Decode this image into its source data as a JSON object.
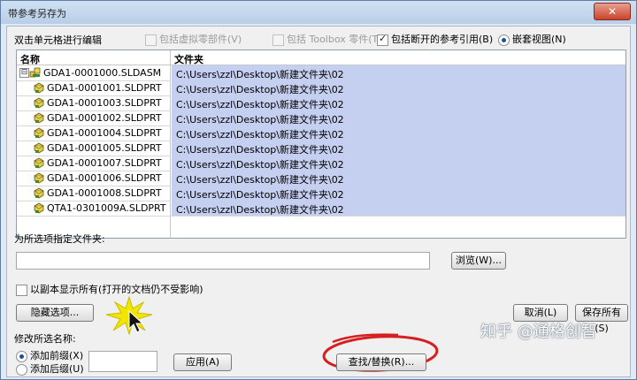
{
  "window": {
    "title": "带参考另存为",
    "close_label": "✕"
  },
  "top_options": {
    "hint": "双击单元格进行编辑",
    "include_virtual": {
      "label": "包括虚拟零部件(V)",
      "checked": false,
      "disabled": true
    },
    "include_toolbox": {
      "label": "包括 Toolbox 零件(T)",
      "checked": false,
      "disabled": true
    },
    "include_broken": {
      "label": "包括断开的参考引用(B)",
      "checked": true,
      "disabled": false
    },
    "nested_view": {
      "label": "嵌套视图(N)",
      "selected": true
    }
  },
  "grid": {
    "columns": [
      "名称",
      "文件夹"
    ],
    "tree_toggle": "⊟",
    "rows": [
      {
        "name": "GDA1-0001000.SLDASM",
        "folder": "C:\\Users\\zzl\\Desktop\\新建文件夹\\02",
        "icon": "assembly-icon"
      },
      {
        "name": "GDA1-0001001.SLDPRT",
        "folder": "C:\\Users\\zzl\\Desktop\\新建文件夹\\02",
        "icon": "part-icon"
      },
      {
        "name": "GDA1-0001003.SLDPRT",
        "folder": "C:\\Users\\zzl\\Desktop\\新建文件夹\\02",
        "icon": "part-icon"
      },
      {
        "name": "GDA1-0001002.SLDPRT",
        "folder": "C:\\Users\\zzl\\Desktop\\新建文件夹\\02",
        "icon": "part-icon"
      },
      {
        "name": "GDA1-0001004.SLDPRT",
        "folder": "C:\\Users\\zzl\\Desktop\\新建文件夹\\02",
        "icon": "part-icon"
      },
      {
        "name": "GDA1-0001005.SLDPRT",
        "folder": "C:\\Users\\zzl\\Desktop\\新建文件夹\\02",
        "icon": "part-icon"
      },
      {
        "name": "GDA1-0001007.SLDPRT",
        "folder": "C:\\Users\\zzl\\Desktop\\新建文件夹\\02",
        "icon": "part-icon"
      },
      {
        "name": "GDA1-0001006.SLDPRT",
        "folder": "C:\\Users\\zzl\\Desktop\\新建文件夹\\02",
        "icon": "part-icon"
      },
      {
        "name": "GDA1-0001008.SLDPRT",
        "folder": "C:\\Users\\zzl\\Desktop\\新建文件夹\\02",
        "icon": "part-icon"
      },
      {
        "name": "QTA1-0301009A.SLDPRT",
        "folder": "C:\\Users\\zzl\\Desktop\\新建文件夹\\02",
        "icon": "part-icon"
      }
    ]
  },
  "folder_section": {
    "label": "为所选项指定文件夹:",
    "value": "",
    "browse_label": "浏览(W)..."
  },
  "copy_option": {
    "label": "以副本显示所有(打开的文档仍不受影响)",
    "checked": false
  },
  "buttons": {
    "hide_options": "隐藏选项...",
    "cancel": "取消(L)",
    "save_all": "保存所有(S)",
    "apply": "应用(A)",
    "find_replace": "查找/替换(R)..."
  },
  "rename_section": {
    "label": "修改所选名称:",
    "add_prefix": {
      "label": "添加前缀(X)",
      "selected": true
    },
    "add_suffix": {
      "label": "添加后缀(U)",
      "selected": false
    },
    "value": ""
  },
  "watermark": "知乎 @通格创智",
  "colors": {
    "selection": "#c5cff0",
    "annotation_ring": "#d42020",
    "cursor_burst": "#f2e600"
  }
}
